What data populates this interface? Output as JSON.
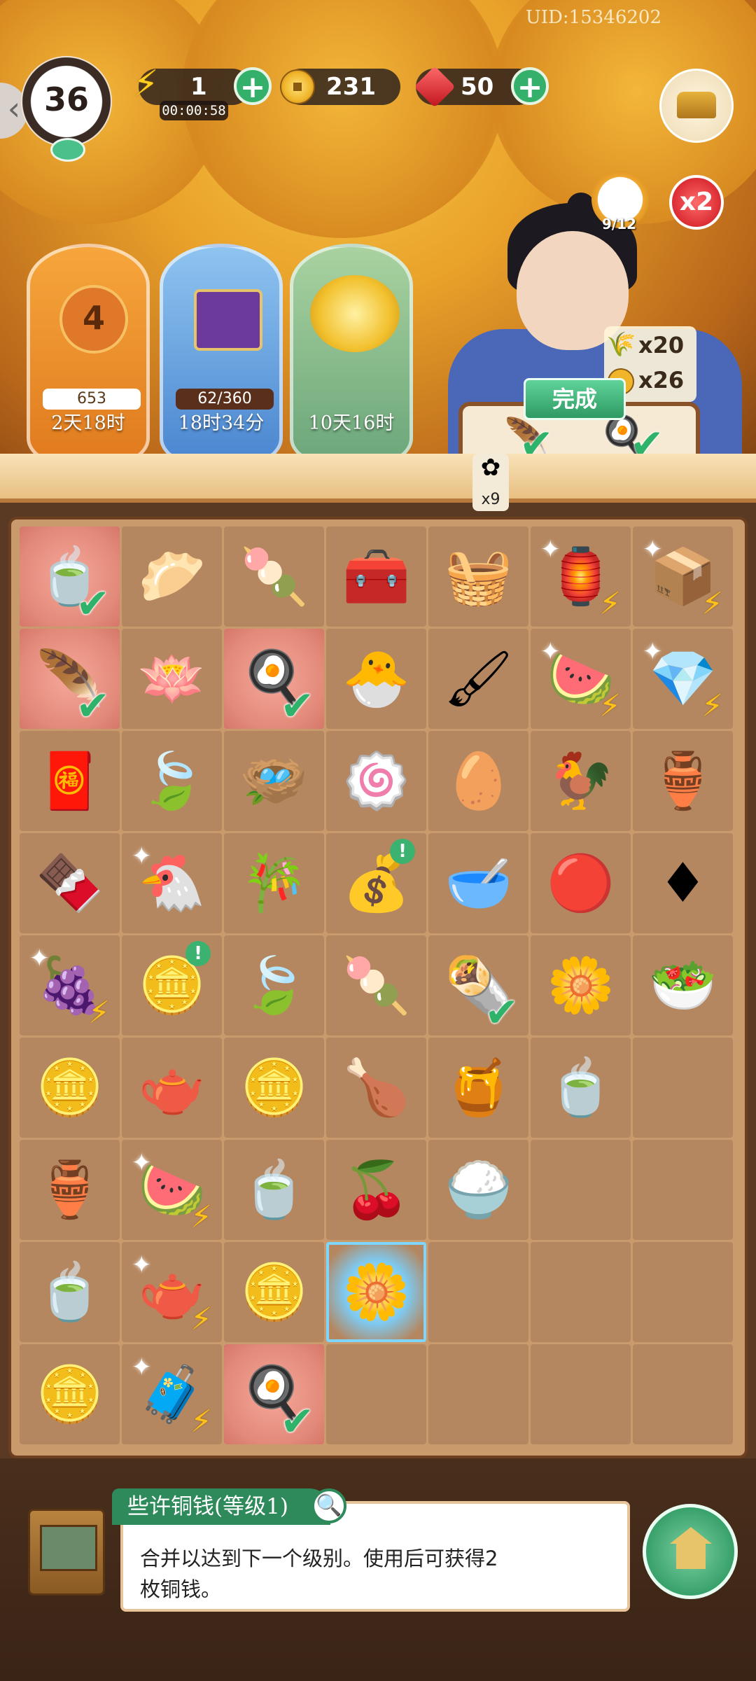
{
  "uid": "UID:15346202",
  "player": {
    "level": "36"
  },
  "resources": {
    "energy": {
      "icon": "lightning-icon",
      "value": "1",
      "timer": "00:00:58"
    },
    "coins": {
      "icon": "copper-coin-icon",
      "value": "231"
    },
    "gems": {
      "icon": "ruby-icon",
      "value": "50"
    }
  },
  "order": {
    "cat_progress": "9/12",
    "multiplier": "x2",
    "rewards": [
      {
        "icon": "wheat-icon",
        "text": "x20"
      },
      {
        "icon": "coin-icon",
        "text": "x26"
      }
    ],
    "done_label": "完成",
    "flower_count": "x9"
  },
  "events": [
    {
      "icon": "pumpkin-icon",
      "badge": "4",
      "progress": "653",
      "timer": "2天18时"
    },
    {
      "icon": "scroll-box-icon",
      "progress": "62/360",
      "timer": "18时34分"
    },
    {
      "icon": "chrysanthemum-icon",
      "timer": "10天16时"
    }
  ],
  "board": {
    "cells": [
      {
        "icon": "🍵",
        "name": "tea-bowl",
        "pink": true,
        "check": true
      },
      {
        "icon": "🥟",
        "name": "steamed-buns"
      },
      {
        "icon": "🍡",
        "name": "peach-bun"
      },
      {
        "icon": "🧰",
        "name": "wooden-chest"
      },
      {
        "icon": "🧺",
        "name": "craft-basket"
      },
      {
        "icon": "🏮",
        "name": "loom",
        "bolt": true,
        "spark": true
      },
      {
        "icon": "📦",
        "name": "scroll-crate",
        "bolt": true,
        "spark": true
      },
      {
        "icon": "🪶",
        "name": "jade-pendant",
        "pink": true,
        "check": true
      },
      {
        "icon": "🪷",
        "name": "purple-compact"
      },
      {
        "icon": "🍳",
        "name": "fried-egg",
        "pink": true,
        "check": true
      },
      {
        "icon": "🐣",
        "name": "chick-nest"
      },
      {
        "icon": "🖌",
        "name": "brush-set"
      },
      {
        "icon": "🍉",
        "name": "fruit-basket",
        "bolt": true,
        "spark": true
      },
      {
        "icon": "💎",
        "name": "gem-chest",
        "bolt": true,
        "spark": true
      },
      {
        "icon": "🧧",
        "name": "red-scrolls"
      },
      {
        "icon": "🍃",
        "name": "silver-leaf"
      },
      {
        "icon": "🪺",
        "name": "empty-nest"
      },
      {
        "icon": "🍥",
        "name": "pink-cakes"
      },
      {
        "icon": "🥚",
        "name": "egg-nest"
      },
      {
        "icon": "🐓",
        "name": "hen-nest"
      },
      {
        "icon": "🏺",
        "name": "energy-jar"
      },
      {
        "icon": "🍫",
        "name": "chocolate-box"
      },
      {
        "icon": "🐔",
        "name": "hen-sparkle",
        "spark": true
      },
      {
        "icon": "🎋",
        "name": "bamboo"
      },
      {
        "icon": "💰",
        "name": "coin-bag",
        "bang": true
      },
      {
        "icon": "🥣",
        "name": "dumpling-soup"
      },
      {
        "icon": "🔴",
        "name": "ruby-small"
      },
      {
        "icon": "♦",
        "name": "ruby-pair"
      },
      {
        "icon": "🍇",
        "name": "grape-basket",
        "bolt": true,
        "spark": true
      },
      {
        "icon": "🪙",
        "name": "coin-pile",
        "bang": true
      },
      {
        "icon": "🍃",
        "name": "silver-leaf"
      },
      {
        "icon": "🍡",
        "name": "pig-cake"
      },
      {
        "icon": "🌯",
        "name": "rolls",
        "check": true
      },
      {
        "icon": "🌼",
        "name": "flower-tea"
      },
      {
        "icon": "🥗",
        "name": "green-soup"
      },
      {
        "icon": "🪙",
        "name": "coin-stack"
      },
      {
        "icon": "🫖",
        "name": "teal-pot"
      },
      {
        "icon": "🪙",
        "name": "coins"
      },
      {
        "icon": "🍗",
        "name": "roast-chicken-bowl"
      },
      {
        "icon": "🍯",
        "name": "honey-cup"
      },
      {
        "icon": "🍵",
        "name": "tea-cup"
      },
      {
        "icon": "",
        "name": "empty"
      },
      {
        "icon": "🏺",
        "name": "green-energy-jar"
      },
      {
        "icon": "🍉",
        "name": "melon-basket",
        "bolt": true,
        "spark": true
      },
      {
        "icon": "🍵",
        "name": "leaf-tea-bowl"
      },
      {
        "icon": "🍒",
        "name": "berry-porridge"
      },
      {
        "icon": "🍚",
        "name": "rice-porridge"
      },
      {
        "icon": "",
        "name": "empty"
      },
      {
        "icon": "",
        "name": "empty"
      },
      {
        "icon": "🍵",
        "name": "tea-cup-blue"
      },
      {
        "icon": "🫖",
        "name": "teapot-tray",
        "bolt": true,
        "spark": true
      },
      {
        "icon": "🪙",
        "name": "single-coin"
      },
      {
        "icon": "🌼",
        "name": "flower-soup-glow",
        "glow": true
      },
      {
        "icon": "",
        "name": "empty"
      },
      {
        "icon": "",
        "name": "empty"
      },
      {
        "icon": "",
        "name": "empty"
      },
      {
        "icon": "🪙",
        "name": "few-coins"
      },
      {
        "icon": "🧳",
        "name": "treasure-chest",
        "bolt": true,
        "spark": true
      },
      {
        "icon": "🍳",
        "name": "fried-egg",
        "pink": true,
        "check": true
      },
      {
        "icon": "",
        "name": "empty"
      },
      {
        "icon": "",
        "name": "empty"
      },
      {
        "icon": "",
        "name": "empty"
      },
      {
        "icon": "",
        "name": "empty"
      }
    ]
  },
  "info": {
    "title": "些许铜钱(等级1)",
    "description_line1": "合并以达到下一个级别。使用后可获得2",
    "description_line2": "枚铜钱。"
  }
}
